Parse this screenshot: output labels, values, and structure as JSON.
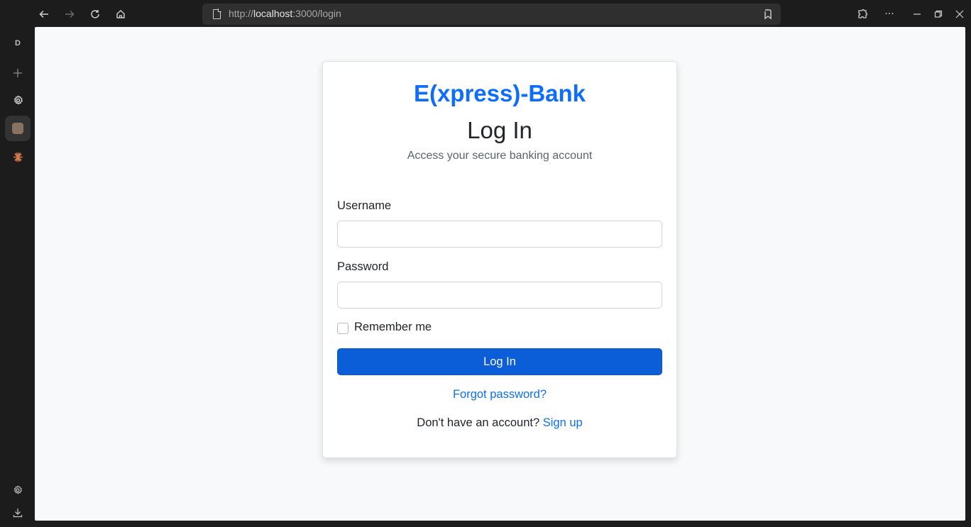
{
  "browser": {
    "url_prefix": "http://",
    "url_host": "localhost",
    "url_rest": ":3000/login",
    "sidebar_profile_letter": "D"
  },
  "page": {
    "brand": "E(xpress)-Bank",
    "heading": "Log In",
    "subheading": "Access your secure banking account",
    "username_label": "Username",
    "username_value": "",
    "password_label": "Password",
    "password_value": "",
    "remember_label": "Remember me",
    "remember_checked": false,
    "submit_label": "Log In",
    "forgot_label": "Forgot password?",
    "signup_prompt": "Don't have an account?",
    "signup_link": "Sign up"
  },
  "colors": {
    "brand": "#0d6efd",
    "button": "#0b5ed7",
    "chrome_bg": "#1c1c1c",
    "page_bg": "#f8f9fa"
  }
}
